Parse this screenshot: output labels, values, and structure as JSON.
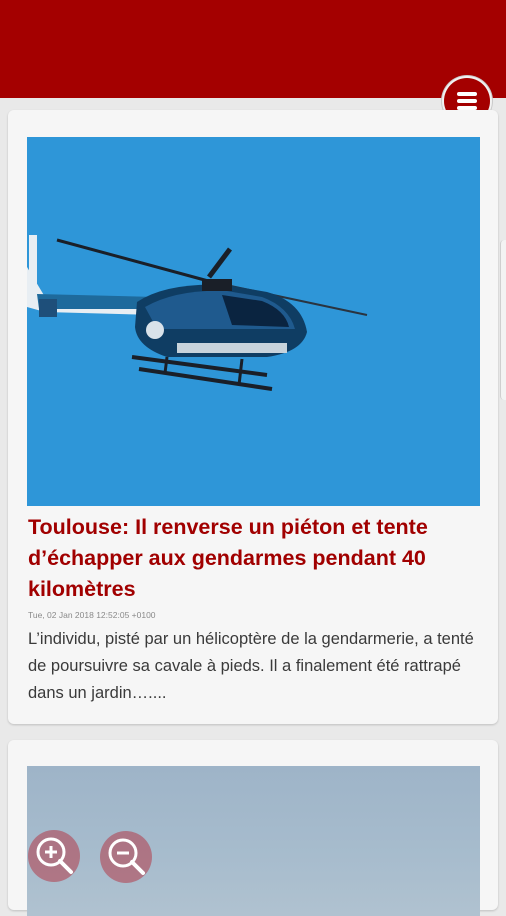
{
  "header": {
    "bar_color": "#a40000",
    "menu_icon": "hamburger-menu-icon"
  },
  "articles": [
    {
      "image": "helicopter-photo",
      "title": "Toulouse: Il renverse un piéton et tente d’échapper aux gendarmes pendant 40 kilomètres",
      "date": "Tue, 02 Jan 2018 12:52:05 +0100",
      "excerpt": "L’individu, pisté par un hélicoptère de la gendarmerie, a tenté de poursuivre sa cavale à pieds. Il a finalement été rattrapé dans un jardin…...."
    },
    {
      "image": "sky-photo"
    }
  ],
  "controls": {
    "zoom_in_icon": "zoom-in-icon",
    "zoom_out_icon": "zoom-out-icon"
  },
  "colors": {
    "accent": "#a40000",
    "title": "#a10000"
  }
}
